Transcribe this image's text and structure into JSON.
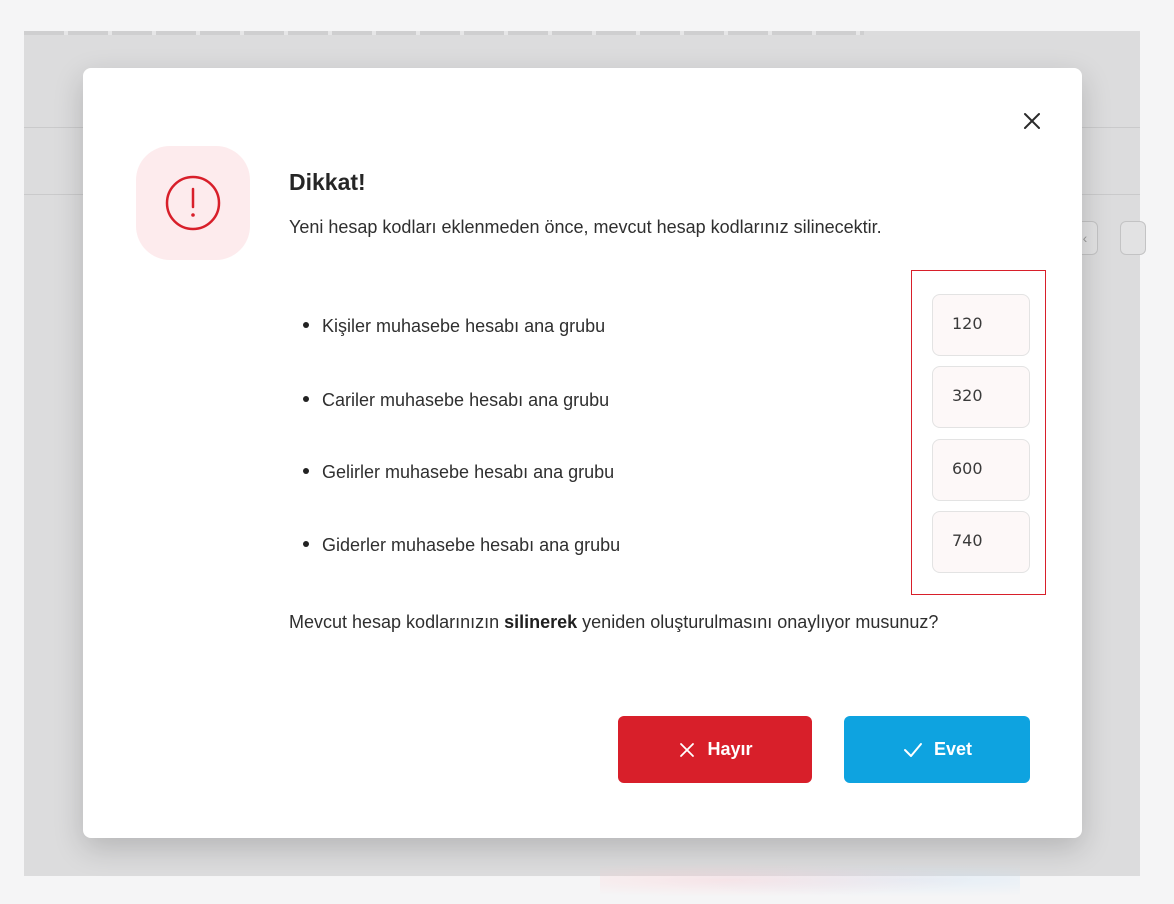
{
  "dialog": {
    "title": "Dikkat!",
    "message": "Yeni hesap kodları eklenmeden önce, mevcut hesap kodlarınız silinecektir.",
    "items": [
      {
        "label": "Kişiler muhasebe hesabı ana grubu",
        "code": "120"
      },
      {
        "label": "Cariler muhasebe hesabı ana grubu",
        "code": "320"
      },
      {
        "label": "Gelirler muhasebe hesabı ana grubu",
        "code": "600"
      },
      {
        "label": "Giderler muhasebe hesabı ana grubu",
        "code": "740"
      }
    ],
    "question_before": "Mevcut hesap kodlarınızın ",
    "question_bold": "silinerek",
    "question_after": " yeniden oluşturulmasını onaylıyor musunuz?",
    "cancel_label": "Hayır",
    "confirm_label": "Evet",
    "icons": {
      "close": "close-icon",
      "alert": "exclamation-circle-icon",
      "cancel": "x-icon",
      "confirm": "check-icon"
    }
  },
  "colors": {
    "danger": "#d81f2a",
    "primary": "#0ea3e0",
    "alert_tile_bg": "#fdebed",
    "overlay_bg": "#dcdcdd"
  }
}
